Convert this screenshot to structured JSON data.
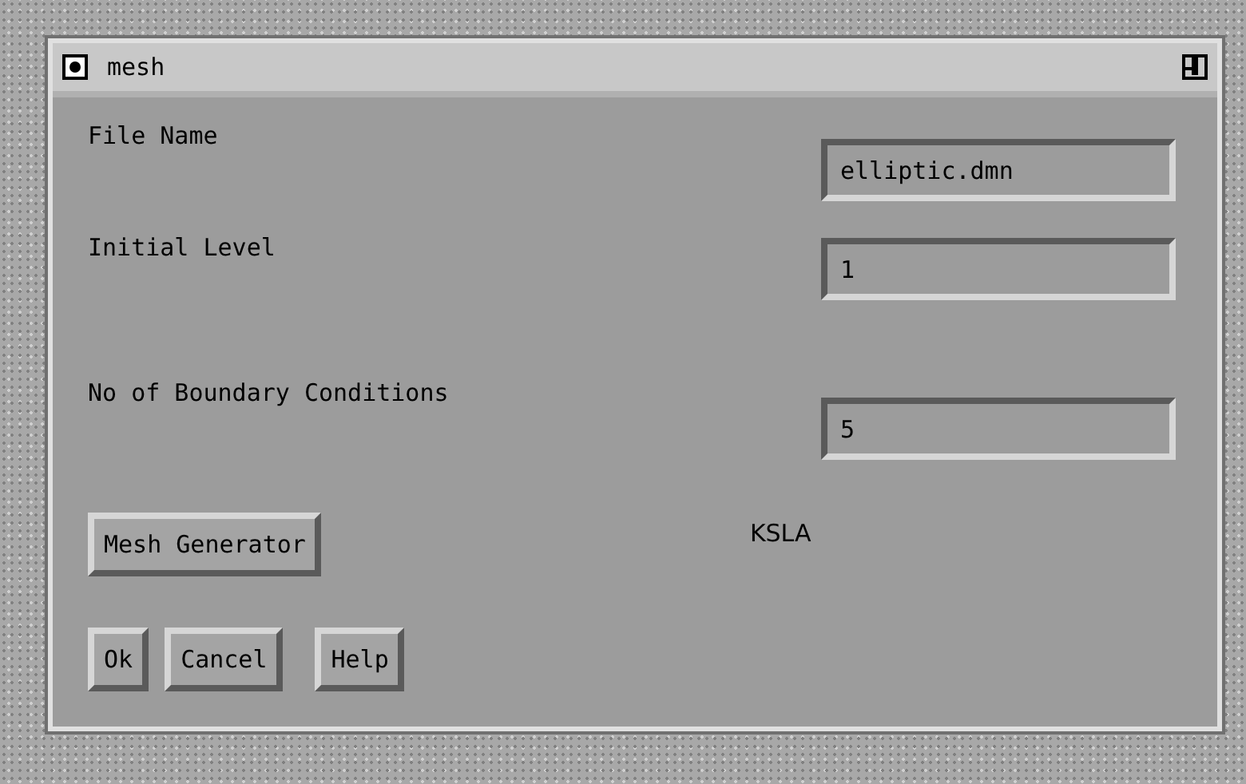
{
  "window": {
    "title": "mesh"
  },
  "fields": [
    {
      "label": "File Name",
      "value": "elliptic.dmn"
    },
    {
      "label": "Initial Level",
      "value": "1"
    },
    {
      "label": "No of Boundary Conditions",
      "value": "5"
    }
  ],
  "tool_button": "Mesh Generator",
  "status_text": "KSLA",
  "buttons": [
    "Ok",
    "Cancel",
    "Help"
  ]
}
